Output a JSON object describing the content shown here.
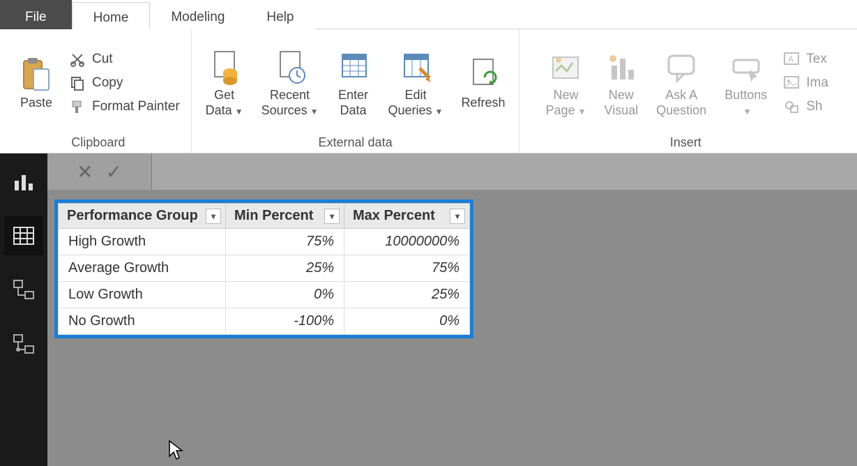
{
  "menu": {
    "file": "File",
    "home": "Home",
    "modeling": "Modeling",
    "help": "Help"
  },
  "ribbon": {
    "clipboard": {
      "label": "Clipboard",
      "paste": "Paste",
      "cut": "Cut",
      "copy": "Copy",
      "format_painter": "Format Painter"
    },
    "external_data": {
      "label": "External data",
      "get_data": "Get\nData",
      "recent_sources": "Recent\nSources",
      "enter_data": "Enter\nData",
      "edit_queries": "Edit\nQueries",
      "refresh": "Refresh"
    },
    "insert": {
      "label": "Insert",
      "new_page": "New\nPage",
      "new_visual": "New\nVisual",
      "ask_a_question": "Ask A\nQuestion",
      "buttons": "Buttons",
      "text": "Tex",
      "image": "Ima",
      "shapes": "Sh"
    }
  },
  "table": {
    "columns": [
      "Performance Group",
      "Min Percent",
      "Max Percent"
    ],
    "rows": [
      {
        "group": "High Growth",
        "min": "75%",
        "max": "10000000%"
      },
      {
        "group": "Average Growth",
        "min": "25%",
        "max": "75%"
      },
      {
        "group": "Low Growth",
        "min": "0%",
        "max": "25%"
      },
      {
        "group": "No Growth",
        "min": "-100%",
        "max": "0%"
      }
    ]
  }
}
